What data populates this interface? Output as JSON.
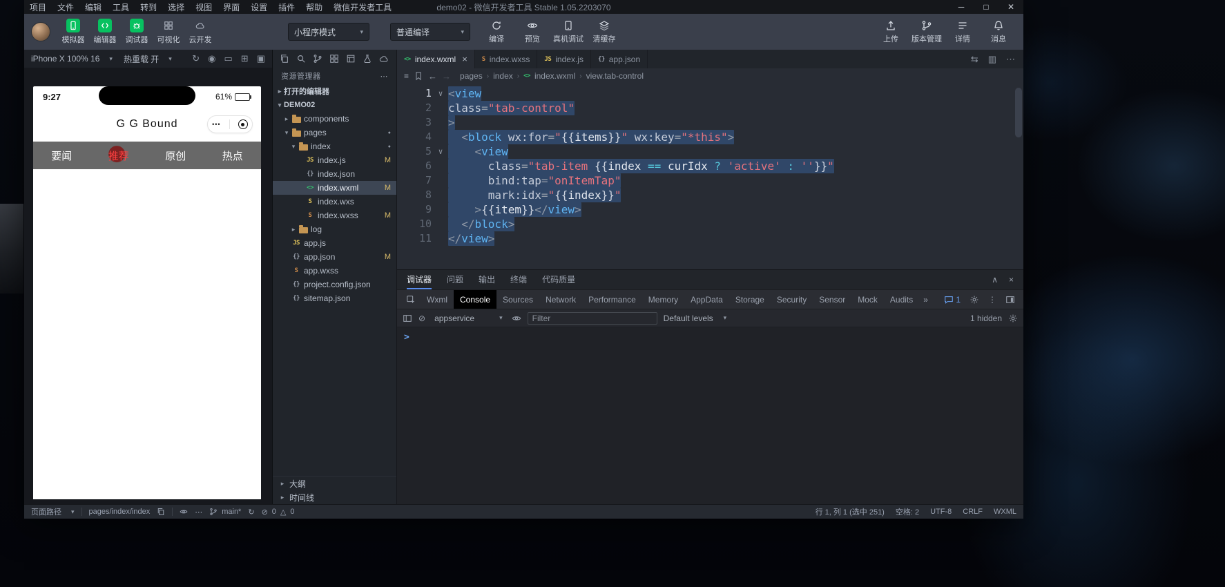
{
  "colors": {
    "wechat_green": "#07c160",
    "selection_blue": "#3a69a9",
    "modified_badge": "#d7ba6a",
    "phone_active_tab_red": "#ff4040"
  },
  "menubar": {
    "items": [
      "项目",
      "文件",
      "编辑",
      "工具",
      "转到",
      "选择",
      "视图",
      "界面",
      "设置",
      "插件",
      "帮助",
      "微信开发者工具"
    ],
    "title": "demo02 - 微信开发者工具 Stable 1.05.2203070",
    "window_controls": {
      "minimize": "─",
      "maximize": "□",
      "close": "✕"
    }
  },
  "toolbar": {
    "toggles": [
      {
        "name": "simulator",
        "label": "模拟器",
        "active": true
      },
      {
        "name": "editor",
        "label": "编辑器",
        "active": true
      },
      {
        "name": "debugger",
        "label": "调试器",
        "active": true
      },
      {
        "name": "visualization",
        "label": "可视化",
        "active": false
      },
      {
        "name": "cloud",
        "label": "云开发",
        "active": false
      }
    ],
    "mode_select": "小程序模式",
    "compile_select": "普通编译",
    "actions": [
      {
        "name": "compile",
        "label": "编译"
      },
      {
        "name": "preview",
        "label": "预览"
      },
      {
        "name": "remote-debug",
        "label": "真机调试"
      },
      {
        "name": "clear-cache",
        "label": "清缓存"
      }
    ],
    "right_actions": [
      {
        "name": "upload",
        "label": "上传"
      },
      {
        "name": "version",
        "label": "版本管理"
      },
      {
        "name": "details",
        "label": "详情"
      },
      {
        "name": "messages",
        "label": "消息"
      }
    ]
  },
  "simulator": {
    "device": "iPhone X 100% 16",
    "hot_reload": "热重载 开",
    "phone": {
      "time": "9:27",
      "battery": "61%",
      "nav_title": "G G Bound",
      "capsule_dots": "•••",
      "tabs": [
        {
          "label": "要闻",
          "active": false
        },
        {
          "label": "推荐",
          "active": true
        },
        {
          "label": "原创",
          "active": false
        },
        {
          "label": "热点",
          "active": false
        }
      ]
    }
  },
  "explorer": {
    "title": "资源管理器",
    "tree": [
      {
        "label": "打开的编辑器",
        "indent": 0,
        "kind": "section",
        "arrow": "collapsed"
      },
      {
        "label": "DEMO02",
        "indent": 0,
        "kind": "section",
        "arrow": "expanded"
      },
      {
        "label": "components",
        "indent": 1,
        "kind": "folder",
        "arrow": "collapsed"
      },
      {
        "label": "pages",
        "indent": 1,
        "kind": "folder",
        "arrow": "expanded",
        "dot": true
      },
      {
        "label": "index",
        "indent": 2,
        "kind": "folder",
        "arrow": "expanded",
        "dot": true
      },
      {
        "label": "index.js",
        "indent": 3,
        "kind": "file",
        "icon": "js",
        "badge": "M"
      },
      {
        "label": "index.json",
        "indent": 3,
        "kind": "file",
        "icon": "json"
      },
      {
        "label": "index.wxml",
        "indent": 3,
        "kind": "file",
        "icon": "wxml",
        "badge": "M",
        "selected": true
      },
      {
        "label": "index.wxs",
        "indent": 3,
        "kind": "file",
        "icon": "wxs"
      },
      {
        "label": "index.wxss",
        "indent": 3,
        "kind": "file",
        "icon": "wxss",
        "badge": "M"
      },
      {
        "label": "log",
        "indent": 2,
        "kind": "folder",
        "arrow": "collapsed"
      },
      {
        "label": "app.js",
        "indent": 1,
        "kind": "file",
        "icon": "js"
      },
      {
        "label": "app.json",
        "indent": 1,
        "kind": "file",
        "icon": "json",
        "badge": "M"
      },
      {
        "label": "app.wxss",
        "indent": 1,
        "kind": "file",
        "icon": "wxss"
      },
      {
        "label": "project.config.json",
        "indent": 1,
        "kind": "file",
        "icon": "json"
      },
      {
        "label": "sitemap.json",
        "indent": 1,
        "kind": "file",
        "icon": "json"
      }
    ],
    "bottom": [
      {
        "label": "大纲"
      },
      {
        "label": "时间线"
      }
    ]
  },
  "editor": {
    "tabs": [
      {
        "label": "index.wxml",
        "icon": "wxml",
        "active": true
      },
      {
        "label": "index.wxss",
        "icon": "wxss",
        "active": false
      },
      {
        "label": "index.js",
        "icon": "js",
        "active": false
      },
      {
        "label": "app.json",
        "icon": "json",
        "active": false
      }
    ],
    "breadcrumb": [
      {
        "label": "pages"
      },
      {
        "label": "index"
      },
      {
        "label": "index.wxml",
        "icon": "wxml"
      },
      {
        "label": "view.tab-control"
      }
    ],
    "code": {
      "folds": [
        1,
        5
      ],
      "lines": [
        [
          [
            "<",
            "p"
          ],
          [
            "view",
            "t"
          ]
        ],
        [
          [
            "class",
            "a"
          ],
          [
            "=",
            "p"
          ],
          [
            "\"tab-control\"",
            "s"
          ]
        ],
        [
          [
            ">",
            "p"
          ]
        ],
        [
          [
            "  ",
            "w"
          ],
          [
            "<",
            "p"
          ],
          [
            "block",
            "t"
          ],
          [
            " ",
            "w"
          ],
          [
            "wx:for",
            "a"
          ],
          [
            "=",
            "p"
          ],
          [
            "\"",
            "s"
          ],
          [
            "{{",
            "b"
          ],
          [
            "items",
            "e"
          ],
          [
            "}}",
            "b"
          ],
          [
            "\"",
            "s"
          ],
          [
            " ",
            "w"
          ],
          [
            "wx:key",
            "a"
          ],
          [
            "=",
            "p"
          ],
          [
            "\"*this\"",
            "s"
          ],
          [
            ">",
            "p"
          ]
        ],
        [
          [
            "    ",
            "w"
          ],
          [
            "<",
            "p"
          ],
          [
            "view",
            "t"
          ]
        ],
        [
          [
            "      ",
            "w"
          ],
          [
            "class",
            "a"
          ],
          [
            "=",
            "p"
          ],
          [
            "\"",
            "s"
          ],
          [
            "tab-item ",
            "s"
          ],
          [
            "{{",
            "b"
          ],
          [
            "index",
            "e"
          ],
          [
            " ",
            "w"
          ],
          [
            "==",
            "o"
          ],
          [
            " ",
            "w"
          ],
          [
            "curIdx",
            "e"
          ],
          [
            " ",
            "w"
          ],
          [
            "?",
            "o"
          ],
          [
            " ",
            "w"
          ],
          [
            "'active'",
            "s"
          ],
          [
            " ",
            "w"
          ],
          [
            ":",
            "o"
          ],
          [
            " ",
            "w"
          ],
          [
            "''",
            "s"
          ],
          [
            "}}",
            "b"
          ],
          [
            "\"",
            "s"
          ]
        ],
        [
          [
            "      ",
            "w"
          ],
          [
            "bind:tap",
            "a"
          ],
          [
            "=",
            "p"
          ],
          [
            "\"onItemTap\"",
            "s"
          ]
        ],
        [
          [
            "      ",
            "w"
          ],
          [
            "mark:idx",
            "a"
          ],
          [
            "=",
            "p"
          ],
          [
            "\"",
            "s"
          ],
          [
            "{{",
            "b"
          ],
          [
            "index",
            "e"
          ],
          [
            "}}",
            "b"
          ],
          [
            "\"",
            "s"
          ]
        ],
        [
          [
            "    ",
            "w"
          ],
          [
            ">",
            "p"
          ],
          [
            "{{",
            "b"
          ],
          [
            "item",
            "e"
          ],
          [
            "}}",
            "b"
          ],
          [
            "</",
            "p"
          ],
          [
            "view",
            "t"
          ],
          [
            ">",
            "p"
          ]
        ],
        [
          [
            "  ",
            "w"
          ],
          [
            "</",
            "p"
          ],
          [
            "block",
            "t"
          ],
          [
            ">",
            "p"
          ]
        ],
        [
          [
            "</",
            "p"
          ],
          [
            "view",
            "t"
          ],
          [
            ">",
            "p"
          ]
        ]
      ]
    }
  },
  "debugger": {
    "panel_tabs": [
      {
        "label": "调试器",
        "active": true
      },
      {
        "label": "问题",
        "active": false
      },
      {
        "label": "输出",
        "active": false
      },
      {
        "label": "终端",
        "active": false
      },
      {
        "label": "代码质量",
        "active": false
      }
    ],
    "devtools_tabs": [
      {
        "label": "Wxml",
        "active": false
      },
      {
        "label": "Console",
        "active": true
      },
      {
        "label": "Sources",
        "active": false
      },
      {
        "label": "Network",
        "active": false
      },
      {
        "label": "Performance",
        "active": false
      },
      {
        "label": "Memory",
        "active": false
      },
      {
        "label": "AppData",
        "active": false
      },
      {
        "label": "Storage",
        "active": false
      },
      {
        "label": "Security",
        "active": false
      },
      {
        "label": "Sensor",
        "active": false
      },
      {
        "label": "Mock",
        "active": false
      },
      {
        "label": "Audits",
        "active": false
      }
    ],
    "overflow": "»",
    "message_count": "1",
    "console": {
      "context": "appservice",
      "filter_placeholder": "Filter",
      "levels": "Default levels",
      "hidden": "1 hidden",
      "prompt": ">"
    }
  },
  "statusbar": {
    "page_path_label": "页面路径",
    "page_path": "pages/index/index",
    "branch": "main*",
    "errors": "0",
    "warnings": "0",
    "cursor": "行 1, 列 1 (选中 251)",
    "spaces": "空格: 2",
    "encoding": "UTF-8",
    "eol": "CRLF",
    "lang": "WXML"
  }
}
